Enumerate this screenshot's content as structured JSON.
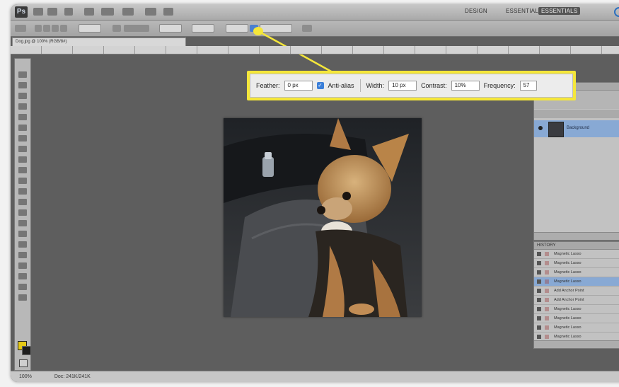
{
  "app": {
    "workspaces": [
      "DESIGN",
      "ESSENTIALS"
    ],
    "active_workspace": "ESSENTIALS",
    "document_tab": "Dog.jpg @ 100% (RGB/8#)"
  },
  "callout": {
    "feather_label": "Feather:",
    "feather_value": "0 px",
    "antialias_label": "Anti-alias",
    "width_label": "Width:",
    "width_value": "10 px",
    "contrast_label": "Contrast:",
    "contrast_value": "10%",
    "frequency_label": "Frequency:",
    "frequency_value": "57"
  },
  "layers_panel": {
    "tab_label": "LAYERS",
    "layer_name": "Background"
  },
  "history_panel": {
    "tab_label": "HISTORY",
    "rows": [
      "Magnetic Lasso",
      "Magnetic Lasso",
      "Magnetic Lasso",
      "Magnetic Lasso",
      "Add Anchor Point",
      "Add Anchor Point",
      "Magnetic Lasso",
      "Magnetic Lasso",
      "Magnetic Lasso",
      "Magnetic Lasso"
    ],
    "selected_index": 3
  },
  "status": {
    "zoom": "100%",
    "doc_info": "Doc: 241K/241K"
  },
  "colors": {
    "callout": "#f5e73a",
    "foreground": "#e5c917",
    "selection": "#88a9d4"
  }
}
